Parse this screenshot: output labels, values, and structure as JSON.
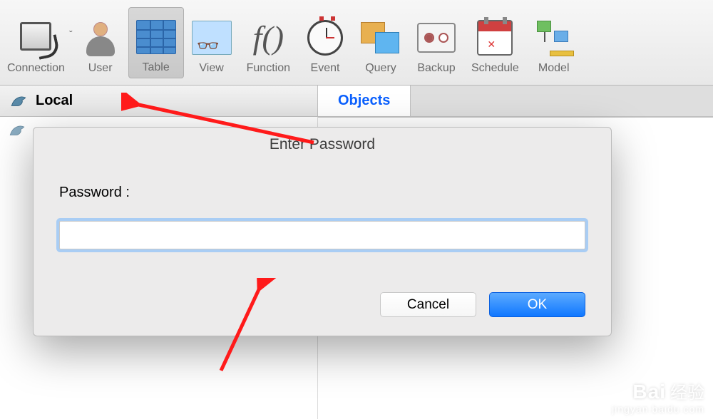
{
  "toolbar": {
    "items": [
      {
        "label": "Connection"
      },
      {
        "label": "User"
      },
      {
        "label": "Table"
      },
      {
        "label": "View"
      },
      {
        "label": "Function"
      },
      {
        "label": "Event"
      },
      {
        "label": "Query"
      },
      {
        "label": "Backup"
      },
      {
        "label": "Schedule"
      },
      {
        "label": "Model"
      }
    ]
  },
  "connection": {
    "name": "Local"
  },
  "tabs": {
    "active": "Objects"
  },
  "dialog": {
    "title": "Enter Password",
    "password_label": "Password :",
    "password_value": "",
    "cancel_label": "Cancel",
    "ok_label": "OK"
  },
  "watermark": {
    "brand": "Bai",
    "brand_suffix": "经验",
    "sub": "jingyan.baidu.com"
  }
}
